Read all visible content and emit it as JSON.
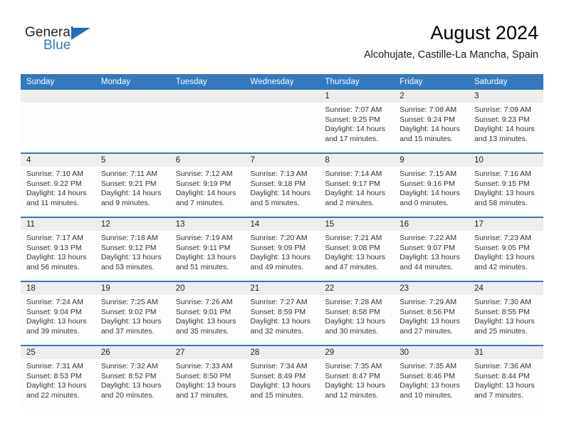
{
  "brand": {
    "name_part1": "General",
    "name_part2": "Blue",
    "flag_icon": "triangle-flag-icon",
    "accent_color": "#2b7cc4"
  },
  "header": {
    "title": "August 2024",
    "subtitle": "Alcohujate, Castille-La Mancha, Spain"
  },
  "theme": {
    "header_blue": "#3578bd",
    "daynum_band": "#eeeeee",
    "cell_bg": "#fdfdfd"
  },
  "weekdays": [
    "Sunday",
    "Monday",
    "Tuesday",
    "Wednesday",
    "Thursday",
    "Friday",
    "Saturday"
  ],
  "weeks": [
    [
      {
        "empty": true
      },
      {
        "empty": true
      },
      {
        "empty": true
      },
      {
        "empty": true
      },
      {
        "day": "1",
        "sunrise": "Sunrise: 7:07 AM",
        "sunset": "Sunset: 9:25 PM",
        "daylight_line1": "Daylight: 14 hours",
        "daylight_line2": "and 17 minutes."
      },
      {
        "day": "2",
        "sunrise": "Sunrise: 7:08 AM",
        "sunset": "Sunset: 9:24 PM",
        "daylight_line1": "Daylight: 14 hours",
        "daylight_line2": "and 15 minutes."
      },
      {
        "day": "3",
        "sunrise": "Sunrise: 7:09 AM",
        "sunset": "Sunset: 9:23 PM",
        "daylight_line1": "Daylight: 14 hours",
        "daylight_line2": "and 13 minutes."
      }
    ],
    [
      {
        "day": "4",
        "sunrise": "Sunrise: 7:10 AM",
        "sunset": "Sunset: 9:22 PM",
        "daylight_line1": "Daylight: 14 hours",
        "daylight_line2": "and 11 minutes."
      },
      {
        "day": "5",
        "sunrise": "Sunrise: 7:11 AM",
        "sunset": "Sunset: 9:21 PM",
        "daylight_line1": "Daylight: 14 hours",
        "daylight_line2": "and 9 minutes."
      },
      {
        "day": "6",
        "sunrise": "Sunrise: 7:12 AM",
        "sunset": "Sunset: 9:19 PM",
        "daylight_line1": "Daylight: 14 hours",
        "daylight_line2": "and 7 minutes."
      },
      {
        "day": "7",
        "sunrise": "Sunrise: 7:13 AM",
        "sunset": "Sunset: 9:18 PM",
        "daylight_line1": "Daylight: 14 hours",
        "daylight_line2": "and 5 minutes."
      },
      {
        "day": "8",
        "sunrise": "Sunrise: 7:14 AM",
        "sunset": "Sunset: 9:17 PM",
        "daylight_line1": "Daylight: 14 hours",
        "daylight_line2": "and 2 minutes."
      },
      {
        "day": "9",
        "sunrise": "Sunrise: 7:15 AM",
        "sunset": "Sunset: 9:16 PM",
        "daylight_line1": "Daylight: 14 hours",
        "daylight_line2": "and 0 minutes."
      },
      {
        "day": "10",
        "sunrise": "Sunrise: 7:16 AM",
        "sunset": "Sunset: 9:15 PM",
        "daylight_line1": "Daylight: 13 hours",
        "daylight_line2": "and 58 minutes."
      }
    ],
    [
      {
        "day": "11",
        "sunrise": "Sunrise: 7:17 AM",
        "sunset": "Sunset: 9:13 PM",
        "daylight_line1": "Daylight: 13 hours",
        "daylight_line2": "and 56 minutes."
      },
      {
        "day": "12",
        "sunrise": "Sunrise: 7:18 AM",
        "sunset": "Sunset: 9:12 PM",
        "daylight_line1": "Daylight: 13 hours",
        "daylight_line2": "and 53 minutes."
      },
      {
        "day": "13",
        "sunrise": "Sunrise: 7:19 AM",
        "sunset": "Sunset: 9:11 PM",
        "daylight_line1": "Daylight: 13 hours",
        "daylight_line2": "and 51 minutes."
      },
      {
        "day": "14",
        "sunrise": "Sunrise: 7:20 AM",
        "sunset": "Sunset: 9:09 PM",
        "daylight_line1": "Daylight: 13 hours",
        "daylight_line2": "and 49 minutes."
      },
      {
        "day": "15",
        "sunrise": "Sunrise: 7:21 AM",
        "sunset": "Sunset: 9:08 PM",
        "daylight_line1": "Daylight: 13 hours",
        "daylight_line2": "and 47 minutes."
      },
      {
        "day": "16",
        "sunrise": "Sunrise: 7:22 AM",
        "sunset": "Sunset: 9:07 PM",
        "daylight_line1": "Daylight: 13 hours",
        "daylight_line2": "and 44 minutes."
      },
      {
        "day": "17",
        "sunrise": "Sunrise: 7:23 AM",
        "sunset": "Sunset: 9:05 PM",
        "daylight_line1": "Daylight: 13 hours",
        "daylight_line2": "and 42 minutes."
      }
    ],
    [
      {
        "day": "18",
        "sunrise": "Sunrise: 7:24 AM",
        "sunset": "Sunset: 9:04 PM",
        "daylight_line1": "Daylight: 13 hours",
        "daylight_line2": "and 39 minutes."
      },
      {
        "day": "19",
        "sunrise": "Sunrise: 7:25 AM",
        "sunset": "Sunset: 9:02 PM",
        "daylight_line1": "Daylight: 13 hours",
        "daylight_line2": "and 37 minutes."
      },
      {
        "day": "20",
        "sunrise": "Sunrise: 7:26 AM",
        "sunset": "Sunset: 9:01 PM",
        "daylight_line1": "Daylight: 13 hours",
        "daylight_line2": "and 35 minutes."
      },
      {
        "day": "21",
        "sunrise": "Sunrise: 7:27 AM",
        "sunset": "Sunset: 8:59 PM",
        "daylight_line1": "Daylight: 13 hours",
        "daylight_line2": "and 32 minutes."
      },
      {
        "day": "22",
        "sunrise": "Sunrise: 7:28 AM",
        "sunset": "Sunset: 8:58 PM",
        "daylight_line1": "Daylight: 13 hours",
        "daylight_line2": "and 30 minutes."
      },
      {
        "day": "23",
        "sunrise": "Sunrise: 7:29 AM",
        "sunset": "Sunset: 8:56 PM",
        "daylight_line1": "Daylight: 13 hours",
        "daylight_line2": "and 27 minutes."
      },
      {
        "day": "24",
        "sunrise": "Sunrise: 7:30 AM",
        "sunset": "Sunset: 8:55 PM",
        "daylight_line1": "Daylight: 13 hours",
        "daylight_line2": "and 25 minutes."
      }
    ],
    [
      {
        "day": "25",
        "sunrise": "Sunrise: 7:31 AM",
        "sunset": "Sunset: 8:53 PM",
        "daylight_line1": "Daylight: 13 hours",
        "daylight_line2": "and 22 minutes."
      },
      {
        "day": "26",
        "sunrise": "Sunrise: 7:32 AM",
        "sunset": "Sunset: 8:52 PM",
        "daylight_line1": "Daylight: 13 hours",
        "daylight_line2": "and 20 minutes."
      },
      {
        "day": "27",
        "sunrise": "Sunrise: 7:33 AM",
        "sunset": "Sunset: 8:50 PM",
        "daylight_line1": "Daylight: 13 hours",
        "daylight_line2": "and 17 minutes."
      },
      {
        "day": "28",
        "sunrise": "Sunrise: 7:34 AM",
        "sunset": "Sunset: 8:49 PM",
        "daylight_line1": "Daylight: 13 hours",
        "daylight_line2": "and 15 minutes."
      },
      {
        "day": "29",
        "sunrise": "Sunrise: 7:35 AM",
        "sunset": "Sunset: 8:47 PM",
        "daylight_line1": "Daylight: 13 hours",
        "daylight_line2": "and 12 minutes."
      },
      {
        "day": "30",
        "sunrise": "Sunrise: 7:35 AM",
        "sunset": "Sunset: 8:46 PM",
        "daylight_line1": "Daylight: 13 hours",
        "daylight_line2": "and 10 minutes."
      },
      {
        "day": "31",
        "sunrise": "Sunrise: 7:36 AM",
        "sunset": "Sunset: 8:44 PM",
        "daylight_line1": "Daylight: 13 hours",
        "daylight_line2": "and 7 minutes."
      }
    ]
  ]
}
